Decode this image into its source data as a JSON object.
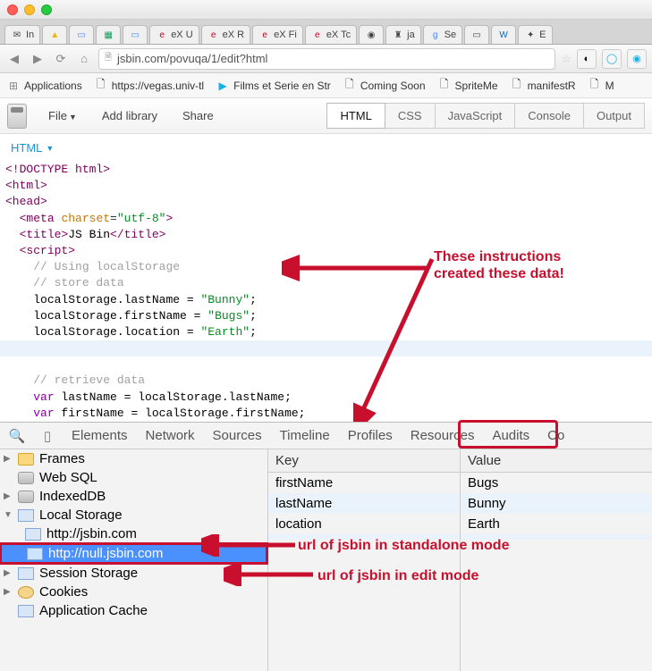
{
  "browser": {
    "tabs": [
      {
        "label": "In"
      },
      {
        "label": ""
      },
      {
        "label": ""
      },
      {
        "label": ""
      },
      {
        "label": ""
      },
      {
        "label": ""
      },
      {
        "label": "eX U"
      },
      {
        "label": "eX R"
      },
      {
        "label": "eX Fi"
      },
      {
        "label": "eX Tc"
      },
      {
        "label": ""
      },
      {
        "label": "ja"
      },
      {
        "label": "Se"
      },
      {
        "label": ""
      },
      {
        "label": ""
      },
      {
        "label": "E"
      }
    ],
    "url": "jsbin.com/povuqa/1/edit?html"
  },
  "bookmarks": [
    {
      "label": "Applications",
      "icon": "apps"
    },
    {
      "label": "https://vegas.univ-tl",
      "icon": "page"
    },
    {
      "label": "Films et Serie en Str",
      "icon": "play"
    },
    {
      "label": "Coming Soon",
      "icon": "page"
    },
    {
      "label": "SpriteMe",
      "icon": "page"
    },
    {
      "label": "manifestR",
      "icon": "page"
    },
    {
      "label": "M",
      "icon": "page"
    }
  ],
  "jsbin": {
    "menu": {
      "file": "File",
      "addlib": "Add library",
      "share": "Share"
    },
    "panels": {
      "html": "HTML",
      "css": "CSS",
      "js": "JavaScript",
      "console": "Console",
      "output": "Output"
    },
    "panelhead": "HTML"
  },
  "code": {
    "l1": "<!DOCTYPE html>",
    "l2": "<html>",
    "l3": "<head>",
    "l4": "  <meta charset=\"utf-8\">",
    "l5": "  <title>JS Bin</title>",
    "l6": "  <script>",
    "l7": "    // Using localStorage",
    "l8": "    // store data",
    "l9": "    localStorage.lastName = \"Bunny\";",
    "l10": "    localStorage.firstName = \"Bugs\";",
    "l11": "    localStorage.location = \"Earth\";",
    "l12": "",
    "l13": "    // retrieve data",
    "l14": "    var lastName = localStorage.lastName;",
    "l15": "    var firstName = localStorage.firstName;"
  },
  "annotations": {
    "top": "These instructions created these data!",
    "mid": "url of jsbin in standalone mode",
    "bot": "url of jsbin in edit mode"
  },
  "devtools": {
    "tabs": {
      "elements": "Elements",
      "network": "Network",
      "sources": "Sources",
      "timeline": "Timeline",
      "profiles": "Profiles",
      "resources": "Resources",
      "audits": "Audits",
      "co": "Co"
    },
    "side": {
      "frames": "Frames",
      "websql": "Web SQL",
      "indexeddb": "IndexedDB",
      "localstorage": "Local Storage",
      "ls1": "http://jsbin.com",
      "ls2": "http://null.jsbin.com",
      "sessionstorage": "Session Storage",
      "cookies": "Cookies",
      "appcache": "Application Cache"
    },
    "table": {
      "keyh": "Key",
      "valueh": "Value",
      "k1": "firstName",
      "v1": "Bugs",
      "k2": "lastName",
      "v2": "Bunny",
      "k3": "location",
      "v3": "Earth"
    }
  }
}
